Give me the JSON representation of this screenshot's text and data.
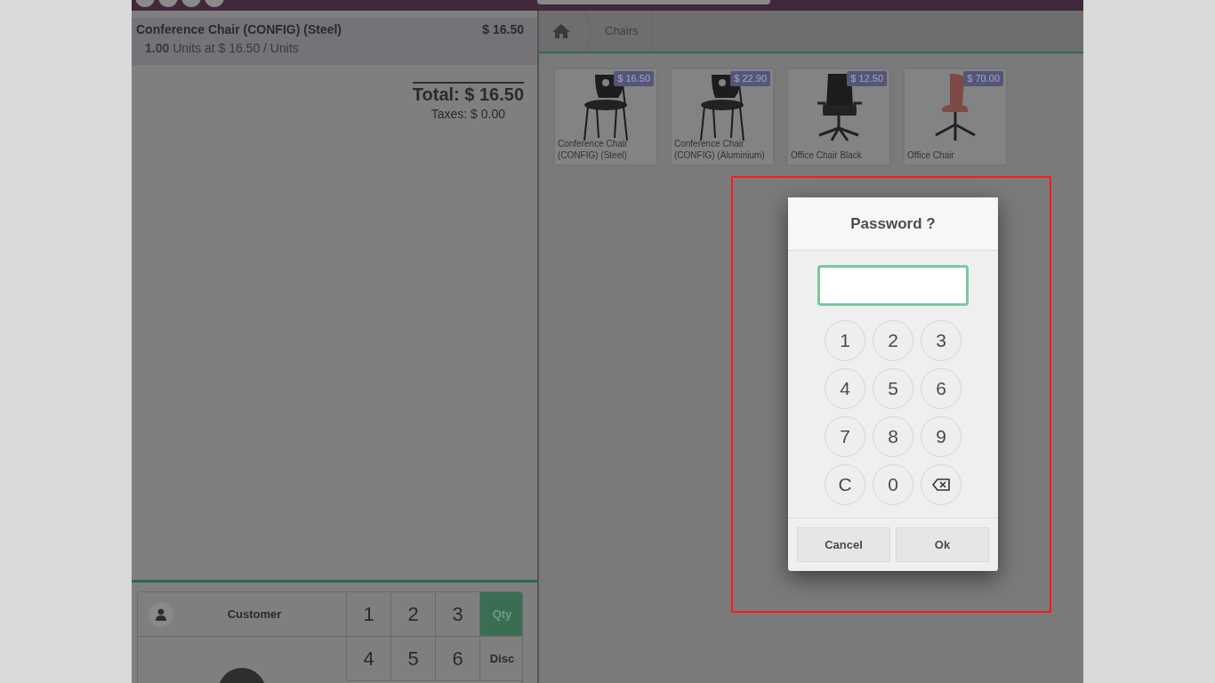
{
  "order": {
    "lines": [
      {
        "name": "Conference Chair (CONFIG) (Steel)",
        "price": "$ 16.50",
        "quantity": "1.00",
        "detail": "Units at $ 16.50 / Units",
        "selected": true
      }
    ],
    "total": "Total: $ 16.50",
    "taxes": "Taxes: $ 0.00"
  },
  "numpad": {
    "customer_button": "Customer",
    "keys": [
      {
        "label": "1",
        "kind": "digit",
        "selected": false
      },
      {
        "label": "2",
        "kind": "digit",
        "selected": false
      },
      {
        "label": "3",
        "kind": "digit",
        "selected": false
      },
      {
        "label": "Qty",
        "kind": "mode",
        "selected": true
      },
      {
        "label": "4",
        "kind": "digit",
        "selected": false
      },
      {
        "label": "5",
        "kind": "digit",
        "selected": false
      },
      {
        "label": "6",
        "kind": "digit",
        "selected": false
      },
      {
        "label": "Disc",
        "kind": "mode",
        "selected": false
      }
    ]
  },
  "breadcrumb": [
    "Chairs"
  ],
  "products": [
    {
      "name": "Conference Chair (CONFIG) (Steel)",
      "price": "$ 16.50",
      "kind": "stacking-chair"
    },
    {
      "name": "Conference Chair (CONFIG) (Aluminium)",
      "price": "$ 22.90",
      "kind": "stacking-chair"
    },
    {
      "name": "Office Chair Black",
      "price": "$ 12.50",
      "kind": "office-chair"
    },
    {
      "name": "Office Chair",
      "price": "$ 70.00",
      "kind": "swivel-chair"
    }
  ],
  "dialog": {
    "title": "Password ?",
    "keys": [
      {
        "label": "1",
        "kind": "digit"
      },
      {
        "label": "2",
        "kind": "digit"
      },
      {
        "label": "3",
        "kind": "digit"
      },
      {
        "label": "4",
        "kind": "digit"
      },
      {
        "label": "5",
        "kind": "digit"
      },
      {
        "label": "6",
        "kind": "digit"
      },
      {
        "label": "7",
        "kind": "digit"
      },
      {
        "label": "8",
        "kind": "digit"
      },
      {
        "label": "9",
        "kind": "digit"
      },
      {
        "label": "C",
        "kind": "digit"
      },
      {
        "label": "0",
        "kind": "digit"
      },
      {
        "kind": "backspace"
      }
    ],
    "buttons": [
      "Cancel",
      "Ok"
    ]
  }
}
